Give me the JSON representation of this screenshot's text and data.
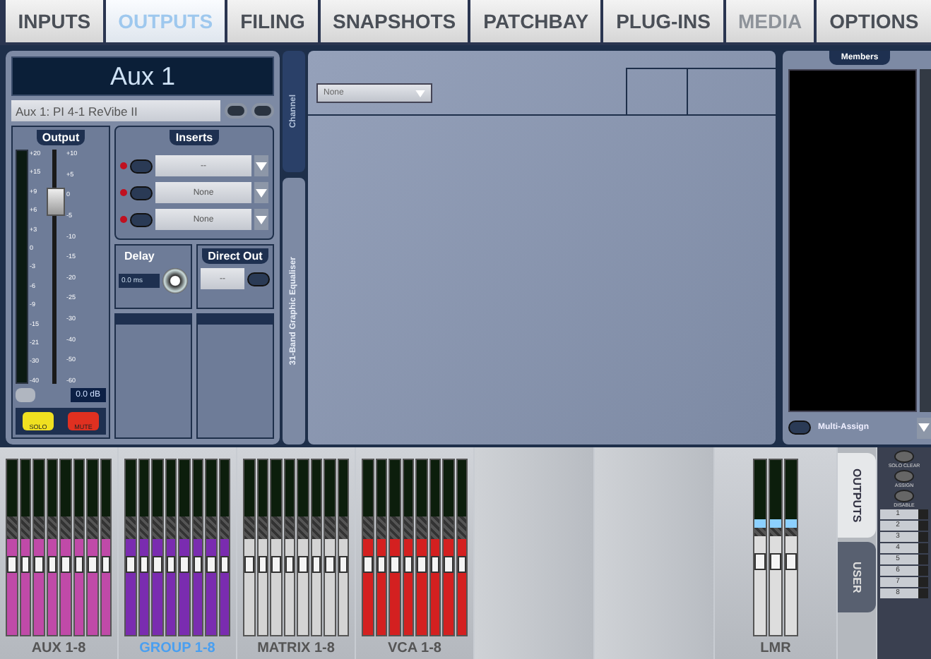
{
  "tabs": [
    {
      "label": "INPUTS",
      "selected": false,
      "disabled": false
    },
    {
      "label": "OUTPUTS",
      "selected": true,
      "disabled": false
    },
    {
      "label": "FILING",
      "selected": false,
      "disabled": false
    },
    {
      "label": "SNAPSHOTS",
      "selected": false,
      "disabled": false
    },
    {
      "label": "PATCHBAY",
      "selected": false,
      "disabled": false
    },
    {
      "label": "PLUG-INS",
      "selected": false,
      "disabled": false
    },
    {
      "label": "MEDIA",
      "selected": false,
      "disabled": true
    },
    {
      "label": "OPTIONS",
      "selected": false,
      "disabled": false
    }
  ],
  "channel": {
    "name": "Aux 1",
    "preset": "Aux 1: PI 4-1 ReVibe II",
    "output": {
      "title": "Output",
      "meter_scale": [
        "+20",
        "+15",
        "+9",
        "+6",
        "+3",
        "0",
        "-3",
        "-6",
        "-9",
        "-15",
        "-21",
        "-30",
        "-40"
      ],
      "fader_scale": [
        "+10",
        "+5",
        "0",
        "-5",
        "-10",
        "-15",
        "-20",
        "-25",
        "-30",
        "-40",
        "-50",
        "-60"
      ],
      "level": 0.78,
      "value": "0.0 dB"
    },
    "inserts": {
      "title": "Inserts",
      "slots": [
        {
          "value": "--",
          "on": false
        },
        {
          "value": "None",
          "on": false
        },
        {
          "value": "None",
          "on": false
        }
      ]
    },
    "delay": {
      "title": "Delay",
      "value": "0.0 ms"
    },
    "direct_out": {
      "title": "Direct Out",
      "value": "--",
      "on": false
    },
    "solo": {
      "label": "SOLO",
      "on": true
    },
    "mute": {
      "label": "MUTE",
      "on": true
    }
  },
  "side_tabs": [
    {
      "label": "Channel",
      "selected": false
    },
    {
      "label": "31-Band Graphic Equaliser",
      "selected": true
    }
  ],
  "editor": {
    "dropdown": "None"
  },
  "members": {
    "title": "Members",
    "multi_assign": {
      "label": "Multi-Assign",
      "on": false
    }
  },
  "banks": [
    {
      "label": "AUX 1-8",
      "selected": false,
      "color": "#c04aa8"
    },
    {
      "label": "GROUP 1-8",
      "selected": true,
      "color": "#7a2cb0"
    },
    {
      "label": "MATRIX 1-8",
      "selected": false,
      "color": "#d4d4d4"
    },
    {
      "label": "VCA 1-8",
      "selected": false,
      "color": "#d42020"
    }
  ],
  "master": {
    "label": "LMR"
  },
  "strip_tabs": [
    {
      "label": "OUTPUTS",
      "selected": true
    },
    {
      "label": "USER",
      "selected": false
    }
  ],
  "right_buttons": [
    "SOLO CLEAR",
    "ASSIGN",
    "DISABLE"
  ],
  "layers": [
    "1",
    "2",
    "3",
    "4",
    "5",
    "6",
    "7",
    "8"
  ]
}
